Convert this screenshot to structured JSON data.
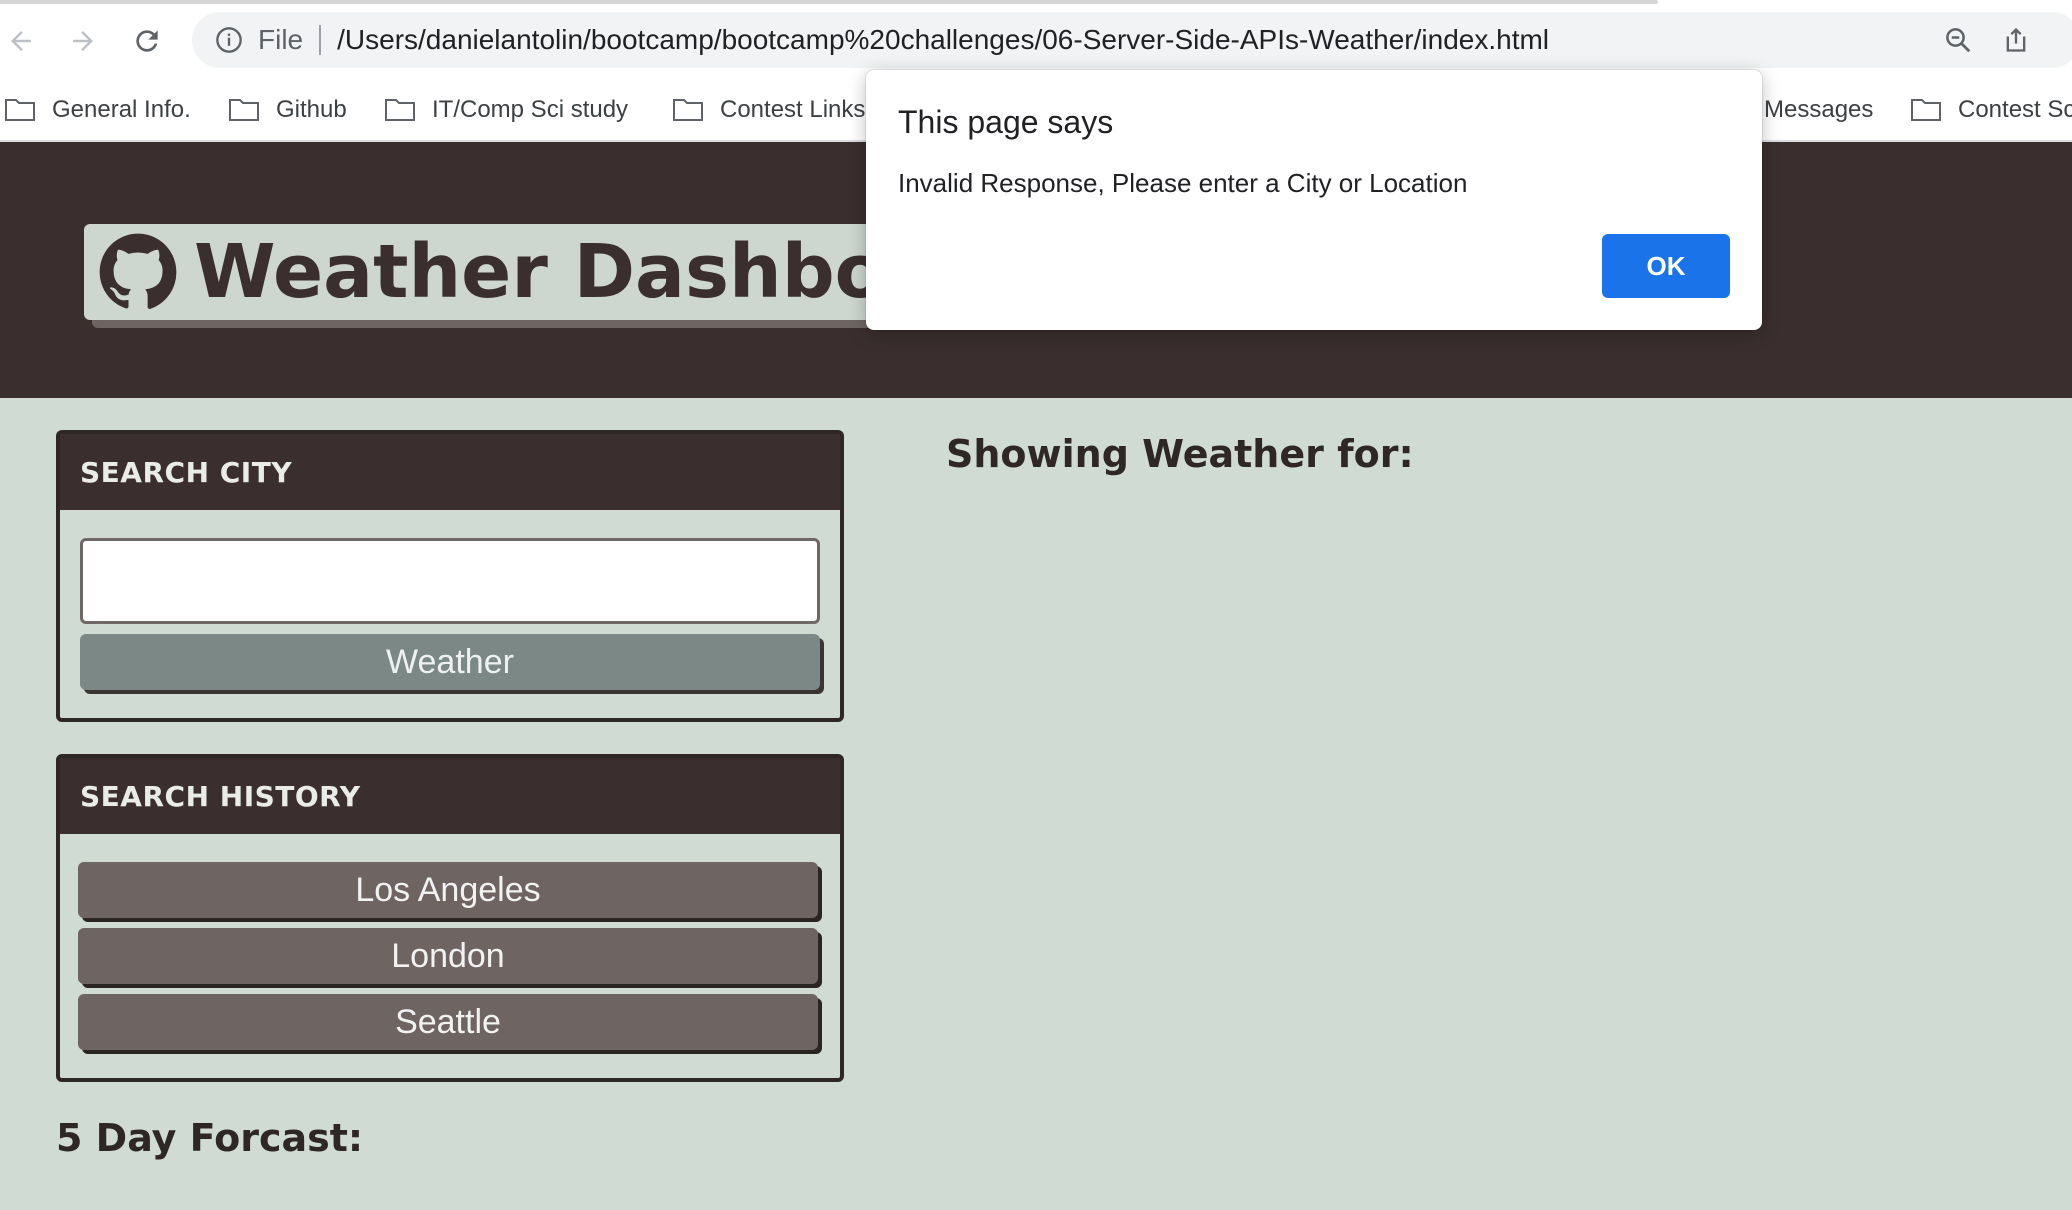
{
  "browser": {
    "address_scheme": "File",
    "url": "/Users/danielantolin/bootcamp/bootcamp%20challenges/06-Server-Side-APIs-Weather/index.html",
    "bookmarks": [
      "General Info.",
      "Github",
      "IT/Comp Sci study",
      "Contest Links",
      "Messages",
      "Contest Sc"
    ]
  },
  "header": {
    "title": "Weather Dashboard"
  },
  "search": {
    "heading": "SEARCH CITY",
    "input_value": "",
    "button_label": "Weather"
  },
  "history": {
    "heading": "SEARCH HISTORY",
    "items": [
      "Los Angeles",
      "London",
      "Seattle"
    ]
  },
  "main": {
    "showing_label": "Showing Weather for:"
  },
  "forecast": {
    "heading": "5 Day Forcast:"
  },
  "dialog": {
    "title": "This page says",
    "message": "Invalid Response, Please enter a City or Location",
    "ok_label": "OK"
  }
}
